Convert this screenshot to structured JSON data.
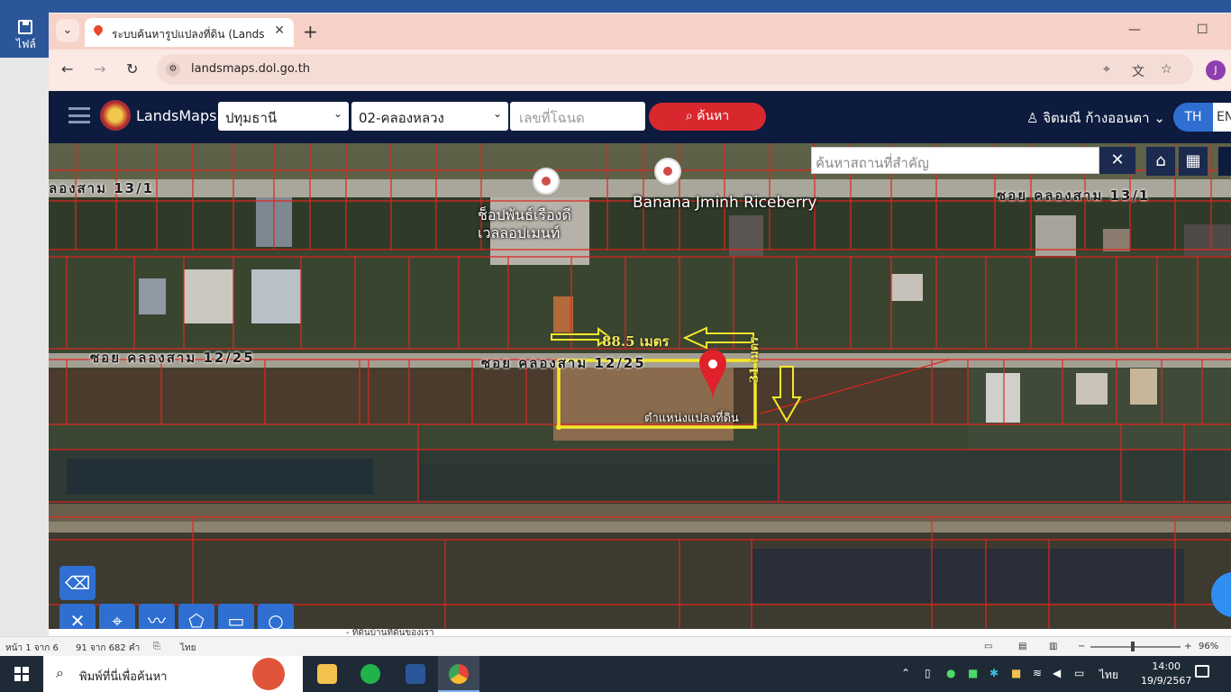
{
  "word": {
    "file_label": "ไฟล์",
    "status": {
      "page": "หน้า 1 จาก 6",
      "words": "91 จาก 682 คำ",
      "language": "ไทย",
      "zoom": "96%"
    },
    "doc_snippet": "- ที่ดินบ้านที่ดินของเรา"
  },
  "browser": {
    "tab_title": "ระบบค้นหารูปแปลงที่ดิน (LandsMaps)",
    "url": "landsmaps.dol.go.th",
    "profile_initial": "J"
  },
  "landsmaps": {
    "brand": "LandsMaps",
    "province": "ปทุมธานี",
    "district": "02-คลองหลวง",
    "parcel_placeholder": "เลขที่โฉนด",
    "search_label": "ค้นหา",
    "user_name": "จิตมณี ก้างออนตา",
    "lang_th": "TH",
    "lang_en": "EN",
    "place_search_placeholder": "ค้นหาสถานที่สำคัญ"
  },
  "map": {
    "road_top_left": "ลองสาม 13/1",
    "road_top_right": "ซอย คลองสาม 13/1",
    "road_mid_left": "ซอย คลองสาม 12/25",
    "road_mid_center": "ซอย คลองสาม 12/25",
    "poi_1": "ช็อปพันธ์เรืองดี\nเวลลอปเมนท์",
    "poi_2": "Banana Jminh Riceberry",
    "width_label": "88.5 เมตร",
    "depth_label": "31 เมตร",
    "parcel_label": "ตำแหน่งแปลงที่ดิน"
  },
  "taskbar": {
    "search_placeholder": "พิมพ์ที่นี่เพื่อค้นหา",
    "input_lang": "ไทย",
    "time": "14:00",
    "date": "19/9/2567"
  }
}
